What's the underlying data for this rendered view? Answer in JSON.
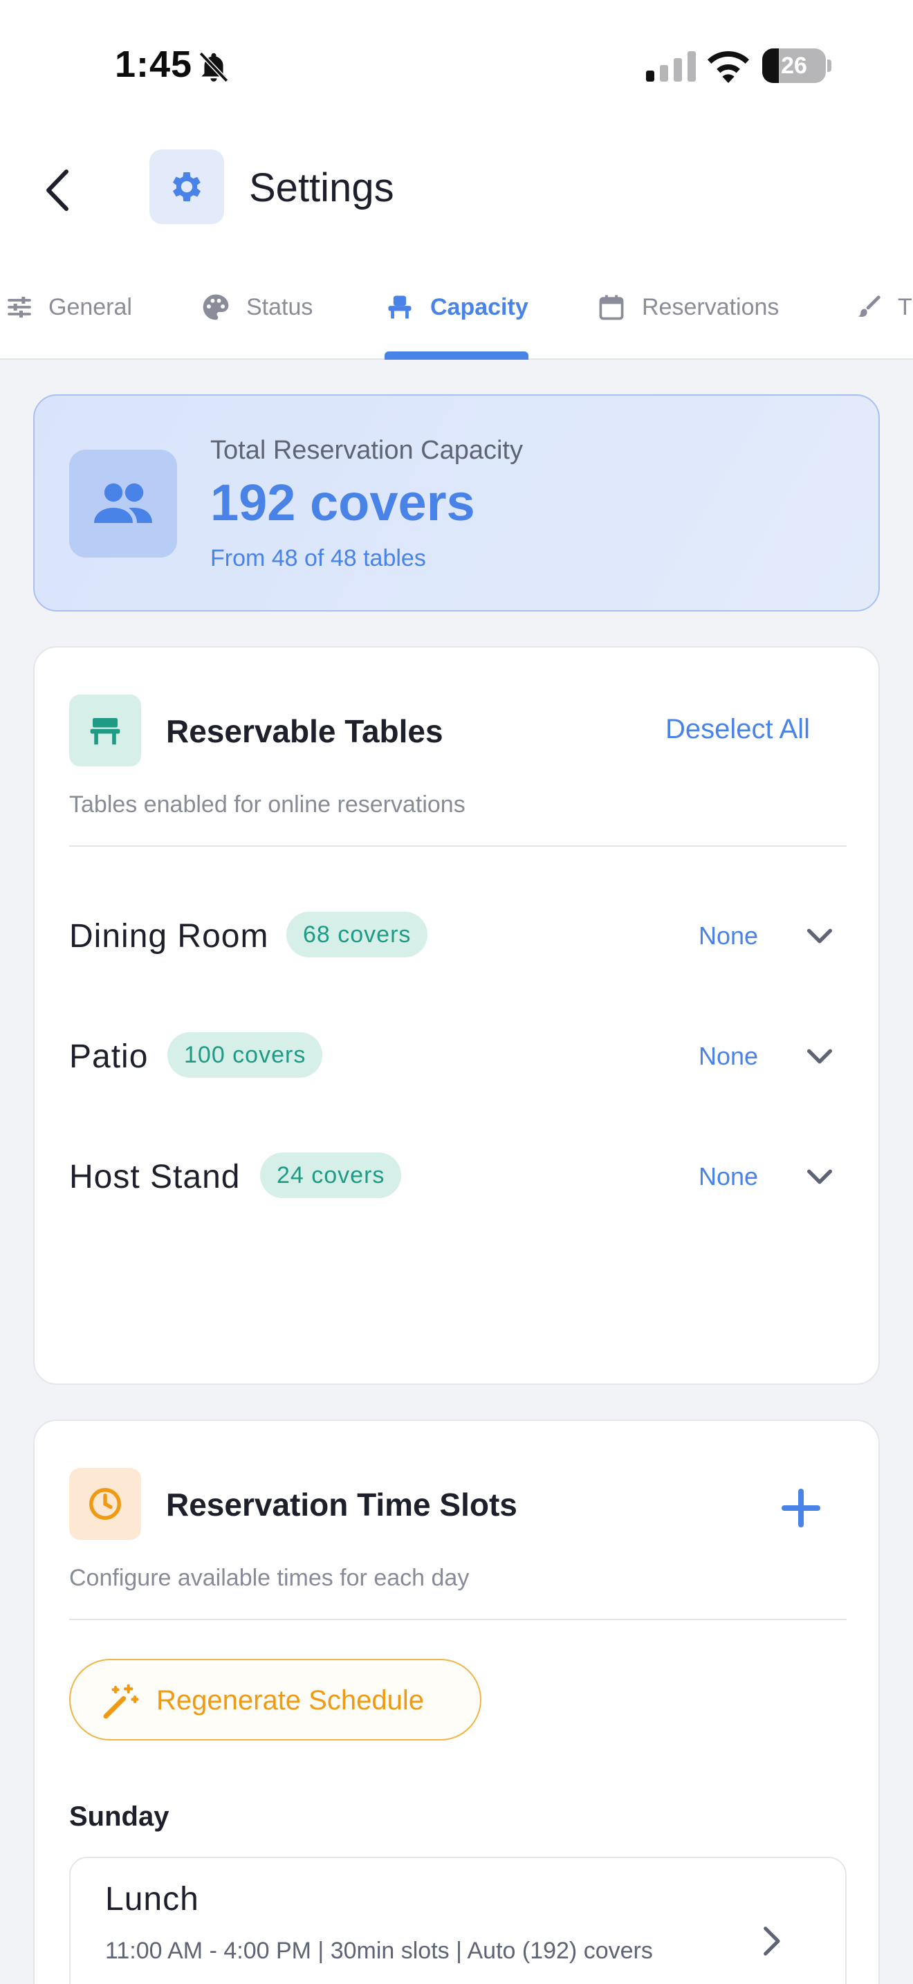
{
  "status_bar": {
    "time": "1:45",
    "battery": "26",
    "icons": [
      "bell-slash-icon",
      "signal-icon",
      "wifi-icon",
      "battery-icon"
    ]
  },
  "header": {
    "title": "Settings",
    "back_icon": "chevron-left-icon",
    "settings_icon": "gear-icon"
  },
  "tabs": [
    {
      "label": "General",
      "icon": "sliders-icon",
      "active": false
    },
    {
      "label": "Status",
      "icon": "palette-icon",
      "active": false
    },
    {
      "label": "Capacity",
      "icon": "chair-icon",
      "active": true
    },
    {
      "label": "Reservations",
      "icon": "calendar-icon",
      "active": false
    },
    {
      "label": "T",
      "icon": "brush-icon",
      "active": false
    }
  ],
  "capacity": {
    "label": "Total Reservation Capacity",
    "value": "192 covers",
    "sub": "From 48 of 48 tables",
    "icon": "people-icon"
  },
  "tables_card": {
    "title": "Reservable Tables",
    "description": "Tables enabled for online reservations",
    "action": "Deselect All",
    "icon": "table-icon",
    "zones": [
      {
        "name": "Dining Room",
        "covers": "68 covers",
        "selection": "None"
      },
      {
        "name": "Patio",
        "covers": "100 covers",
        "selection": "None"
      },
      {
        "name": "Host Stand",
        "covers": "24 covers",
        "selection": "None"
      }
    ]
  },
  "timeslots_card": {
    "title": "Reservation Time Slots",
    "description": "Configure available times for each day",
    "icon": "clock-icon",
    "regenerate_label": "Regenerate Schedule",
    "day": "Sunday",
    "slots": [
      {
        "name": "Lunch",
        "detail": "11:00 AM - 4:00 PM | 30min slots | Auto (192) covers"
      }
    ]
  },
  "colors": {
    "accent": "#4a83e8",
    "teal": "#1f9a84",
    "orange": "#f09a14"
  }
}
